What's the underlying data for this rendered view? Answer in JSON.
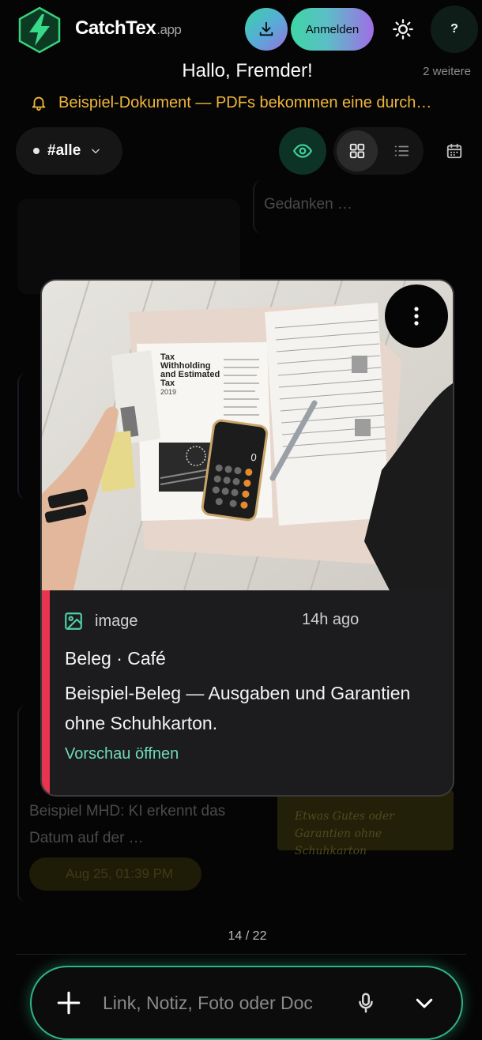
{
  "header": {
    "brand_name": "CatchTex",
    "brand_suffix": ".app",
    "login_label": "Anmelden",
    "help_label": "?"
  },
  "greeting": "Hallo, Fremder!",
  "more_count": "2 weitere",
  "announcement": "Beispiel-Dokument — PDFs bekommen eine durch…",
  "toolbar": {
    "filter_label": "#alle",
    "active_view": "grid"
  },
  "background": {
    "top_right_text": "Gedanken …",
    "lower_left_text": "Beispiel MHD: KI erkennt das Datum auf der …",
    "reminder_text": "Aug 25, 01:39 PM",
    "note_text": "Etwas Gutes oder Garantien ohne Schuhkarton"
  },
  "card": {
    "type_label": "image",
    "time": "14h ago",
    "title": "Beleg · Café",
    "description": "Beispiel-Beleg — Ausgaben und Garantien ohne Schuhkarton.",
    "link_label": "Vorschau öffnen",
    "accent_color": "#e8354f",
    "image_doc_heading": "Tax Withholding and Estimated Tax",
    "image_doc_year": "2019"
  },
  "pager": "14 / 22",
  "composer": {
    "placeholder": "Link, Notiz, Foto oder Doc"
  },
  "colors": {
    "brand_green": "#39d98a",
    "accent_teal": "#6ed9b4",
    "warning": "#f0b63c"
  }
}
